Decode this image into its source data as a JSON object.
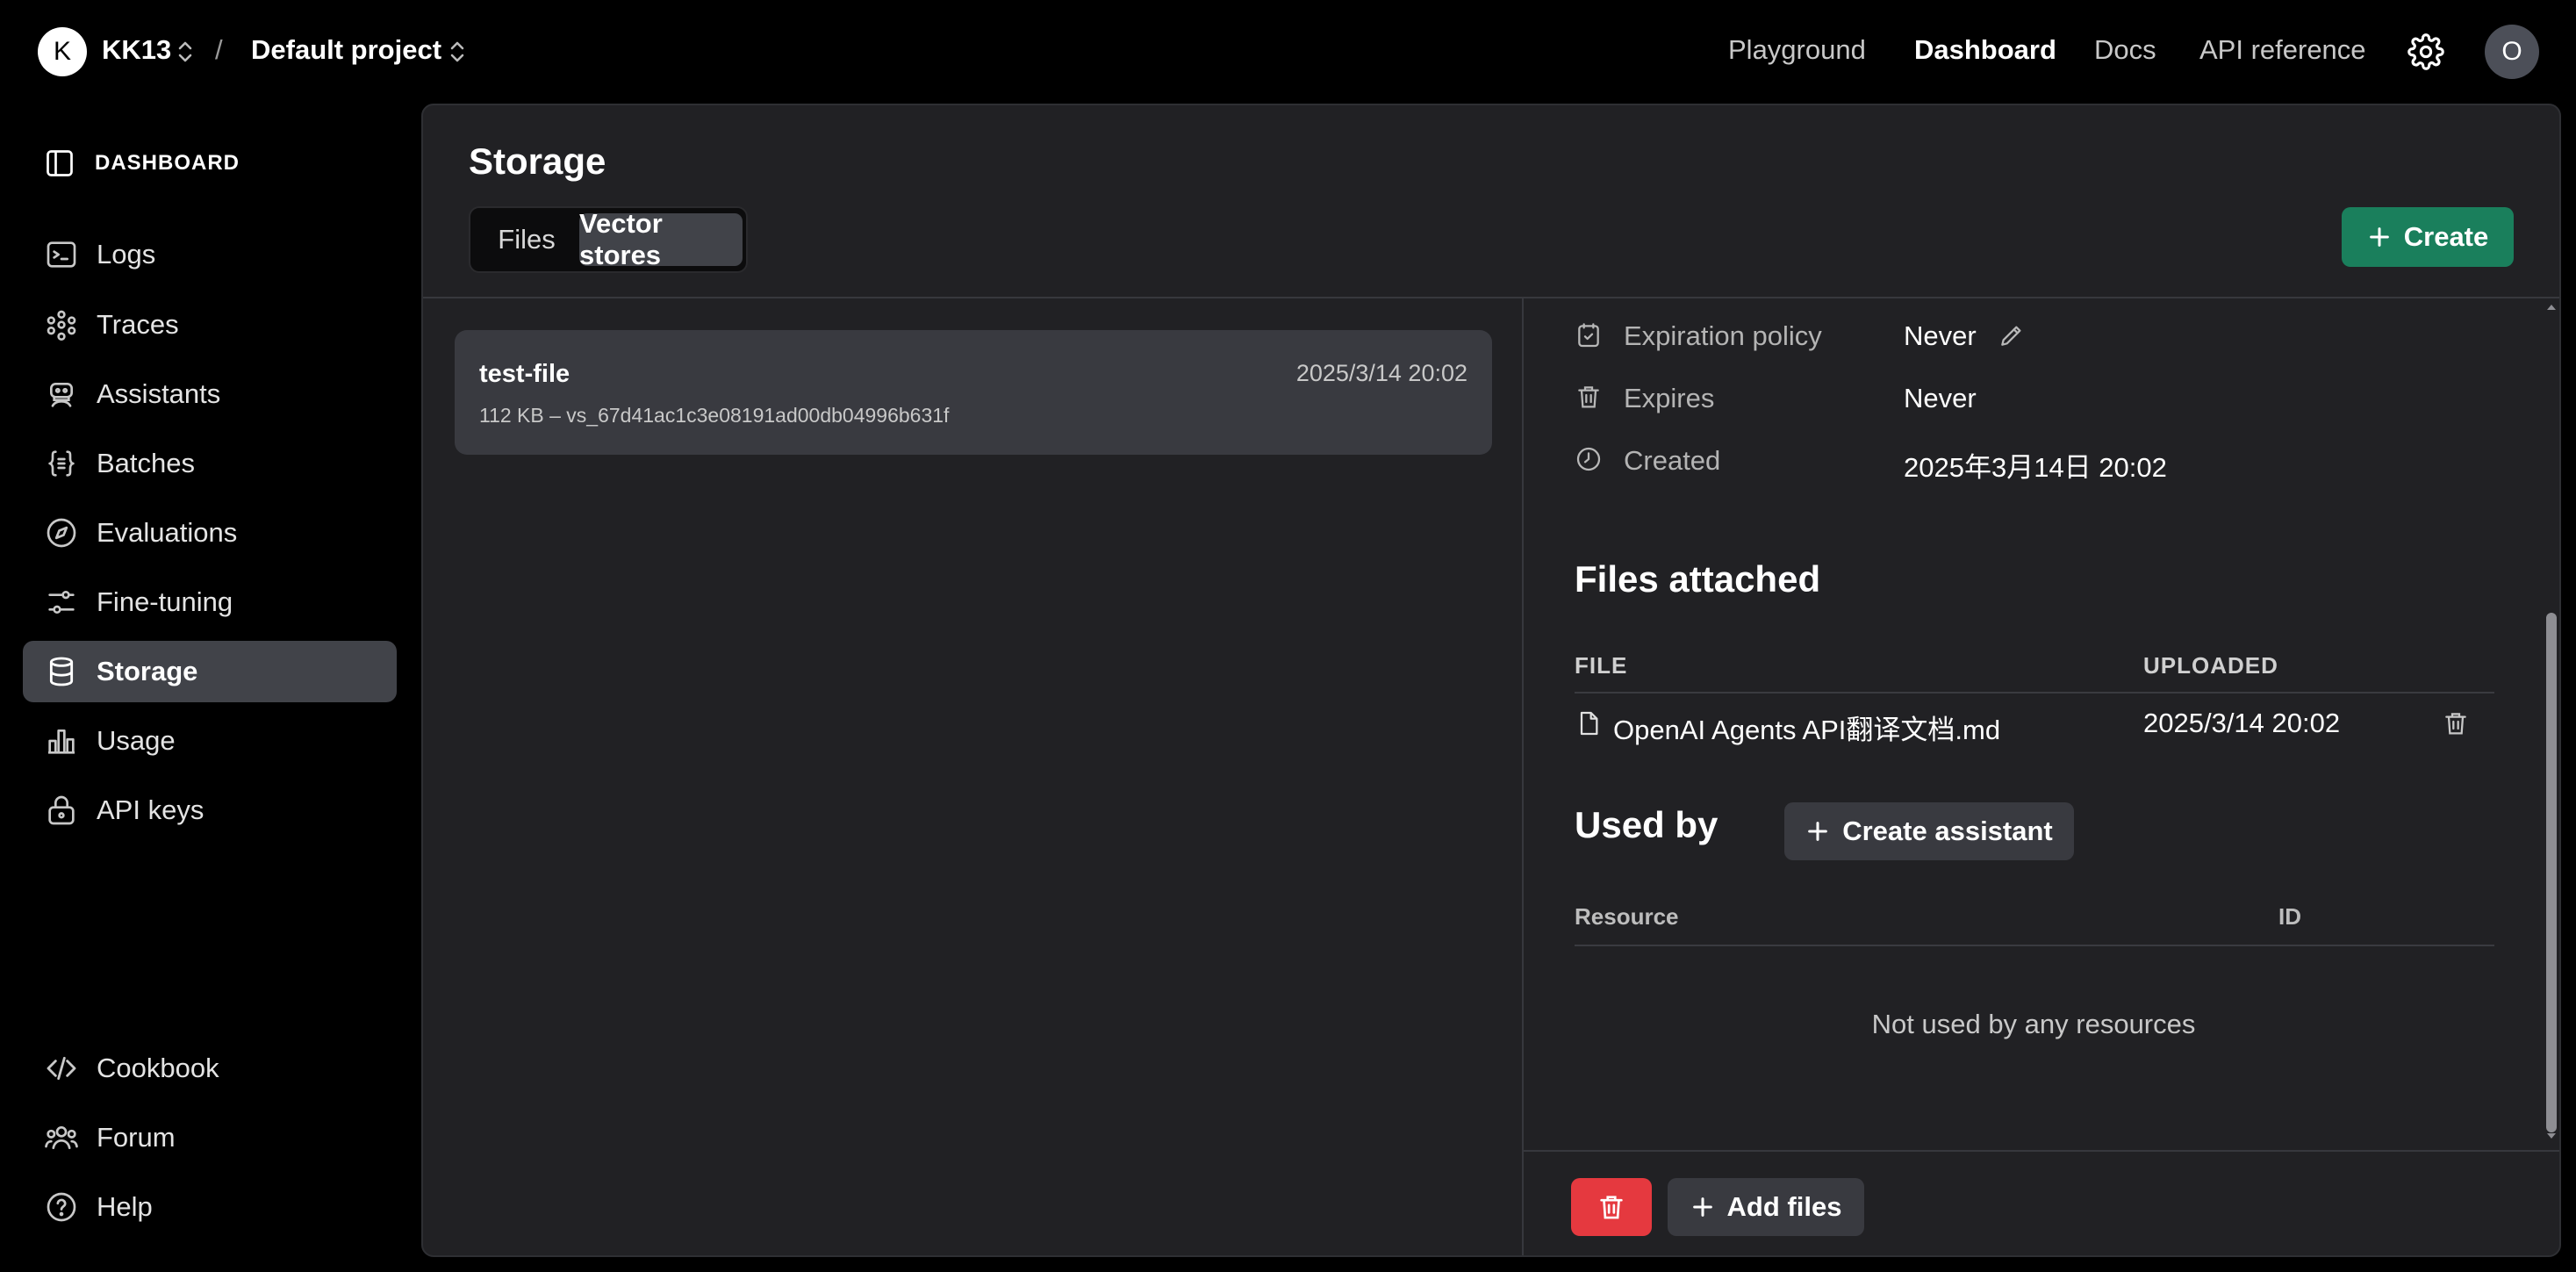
{
  "topbar": {
    "org_initial": "K",
    "org_name": "KK13",
    "separator": "/",
    "project_name": "Default project",
    "nav": [
      "Playground",
      "Dashboard",
      "Docs",
      "API reference"
    ],
    "active_nav": "Dashboard",
    "user_initial": "O"
  },
  "sidebar": {
    "header": "DASHBOARD",
    "items": [
      {
        "label": "Logs",
        "icon": "terminal-icon"
      },
      {
        "label": "Traces",
        "icon": "traces-icon"
      },
      {
        "label": "Assistants",
        "icon": "robot-icon"
      },
      {
        "label": "Batches",
        "icon": "braces-icon"
      },
      {
        "label": "Evaluations",
        "icon": "compass-icon"
      },
      {
        "label": "Fine-tuning",
        "icon": "sliders-icon"
      },
      {
        "label": "Storage",
        "icon": "database-icon"
      },
      {
        "label": "Usage",
        "icon": "bar-chart-icon"
      },
      {
        "label": "API keys",
        "icon": "lock-icon"
      }
    ],
    "active_item": "Storage",
    "bottom_items": [
      {
        "label": "Cookbook",
        "icon": "code-icon"
      },
      {
        "label": "Forum",
        "icon": "people-icon"
      },
      {
        "label": "Help",
        "icon": "help-icon"
      }
    ]
  },
  "main": {
    "title": "Storage",
    "tabs": [
      "Files",
      "Vector stores"
    ],
    "active_tab": "Vector stores",
    "create_label": "Create",
    "stores": [
      {
        "name": "test-file",
        "date": "2025/3/14 20:02",
        "meta": "112 KB – vs_67d41ac1c3e08191ad00db04996b631f"
      }
    ],
    "detail": {
      "props": [
        {
          "label": "Expiration policy",
          "value": "Never",
          "icon": "calendar-check-icon"
        },
        {
          "label": "Expires",
          "value": "Never",
          "icon": "trash-icon"
        },
        {
          "label": "Created",
          "value": "2025年3月14日 20:02",
          "icon": "clock-icon"
        }
      ],
      "files_title": "Files attached",
      "files_columns": [
        "FILE",
        "UPLOADED"
      ],
      "files": [
        {
          "name": "OpenAI Agents API翻译文档.md",
          "uploaded": "2025/3/14 20:02"
        }
      ],
      "used_by_title": "Used by",
      "create_assistant_label": "Create assistant",
      "used_columns": [
        "Resource",
        "ID"
      ],
      "empty_text": "Not used by any resources",
      "add_files_label": "Add files"
    }
  },
  "colors": {
    "accent_green": "#1a7f5c",
    "danger_red": "#e5393f",
    "panel_bg": "#212124"
  }
}
